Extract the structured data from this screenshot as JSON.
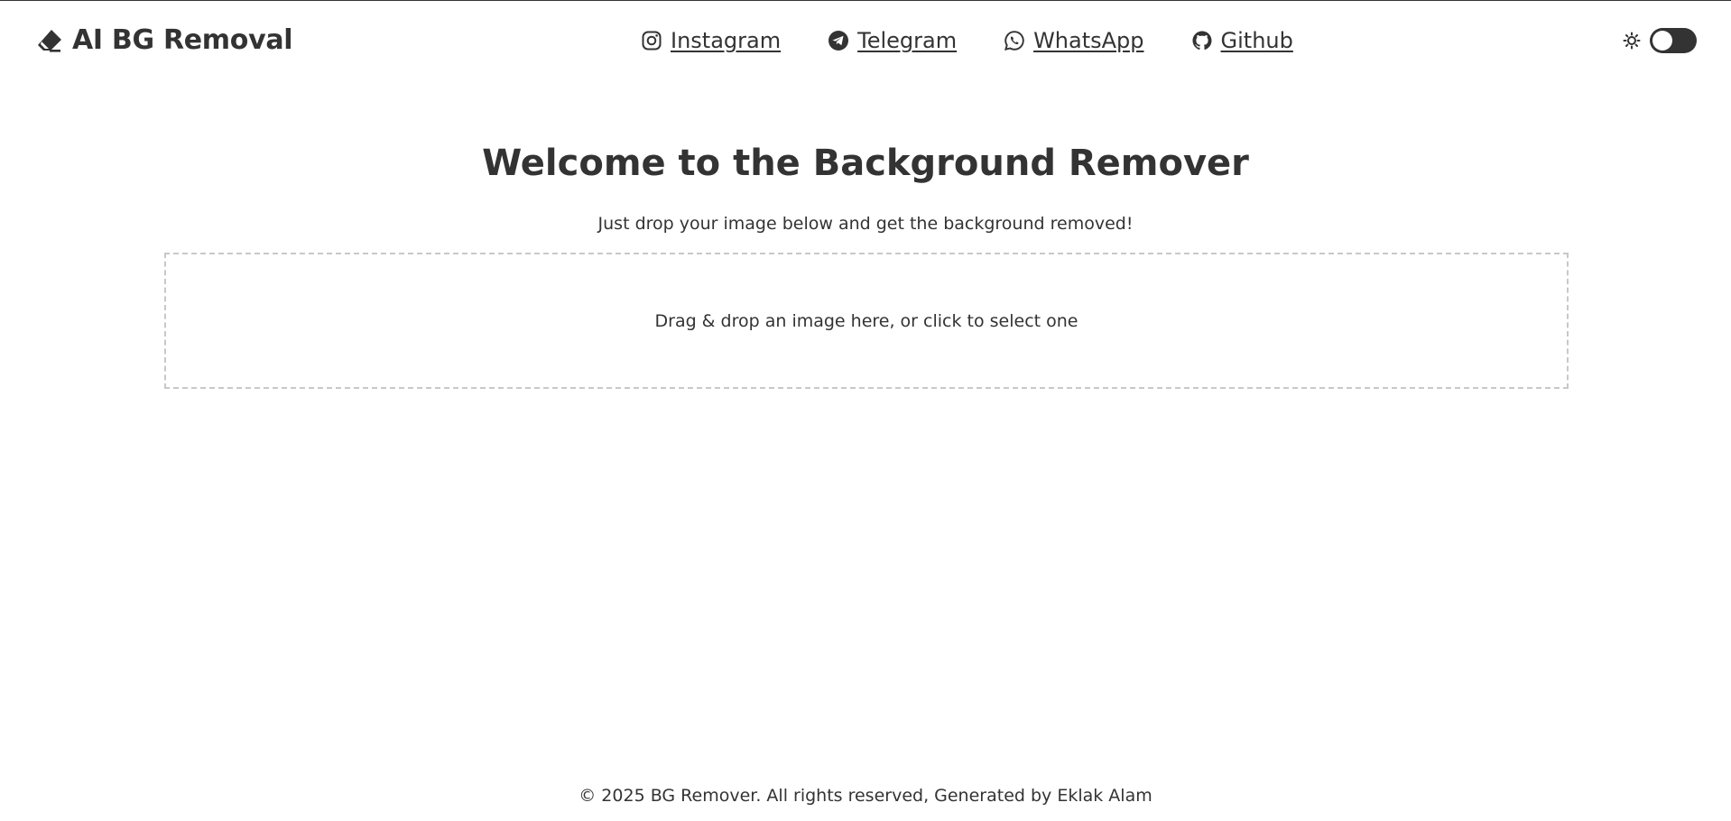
{
  "header": {
    "brand": {
      "title": "AI BG Removal",
      "icon": "eraser-icon"
    },
    "nav": [
      {
        "label": "Instagram",
        "icon": "instagram-icon"
      },
      {
        "label": "Telegram",
        "icon": "telegram-icon"
      },
      {
        "label": "WhatsApp",
        "icon": "whatsapp-icon"
      },
      {
        "label": "Github",
        "icon": "github-icon"
      }
    ],
    "theme": {
      "icon": "sun-icon",
      "toggle_state": "off"
    }
  },
  "main": {
    "title": "Welcome to the Background Remover",
    "subtitle": "Just drop your image below and get the background removed!",
    "dropzone": {
      "text": "Drag & drop an image here, or click to select one"
    }
  },
  "footer": {
    "text": "© 2025 BG Remover. All rights reserved, Generated by Eklak Alam"
  },
  "colors": {
    "text": "#333333",
    "background": "#ffffff",
    "dropzone_border": "#c8c8c8"
  }
}
